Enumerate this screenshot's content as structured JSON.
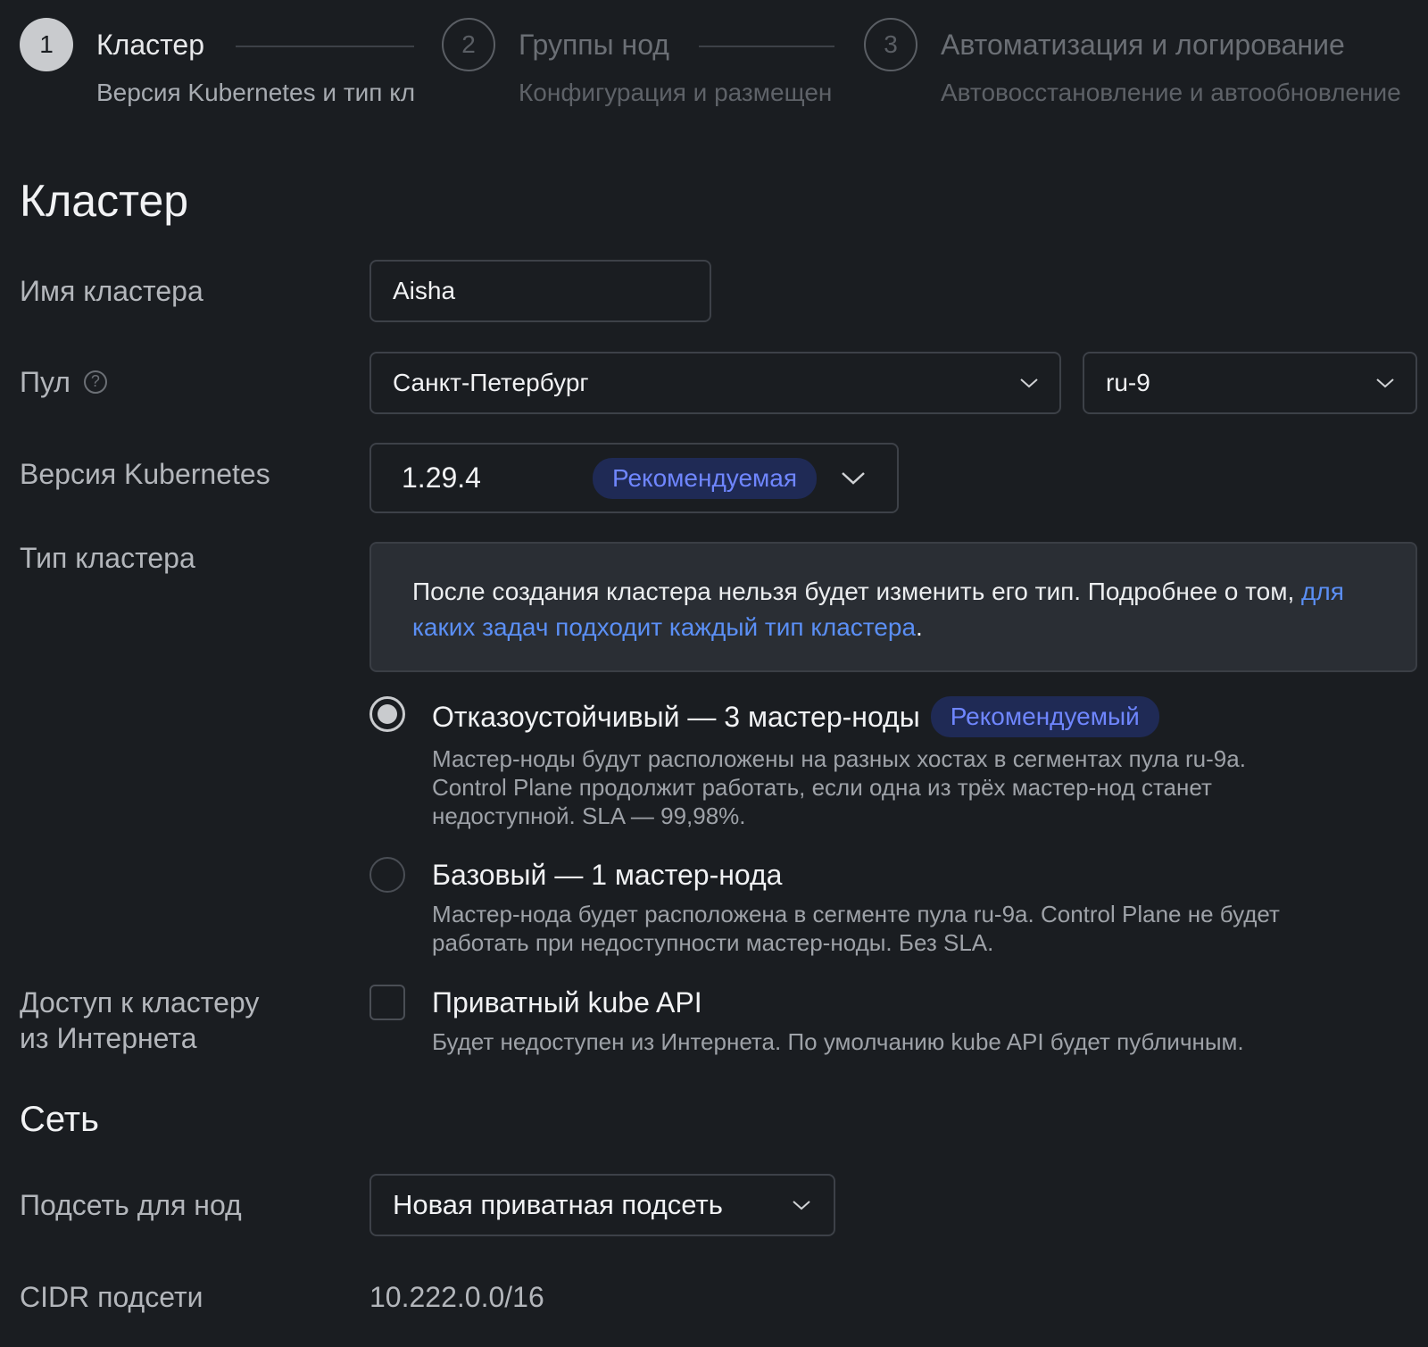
{
  "stepper": {
    "steps": [
      {
        "number": "1",
        "title": "Кластер",
        "subtitle": "Версия Kubernetes и тип кл"
      },
      {
        "number": "2",
        "title": "Группы нод",
        "subtitle": "Конфигурация и размещен"
      },
      {
        "number": "3",
        "title": "Автоматизация и логирование",
        "subtitle": "Автовосстановление и автообновление"
      }
    ]
  },
  "cluster_section": {
    "title": "Кластер",
    "name": {
      "label": "Имя кластера",
      "value": "Aisha"
    },
    "pool": {
      "label": "Пул",
      "region_value": "Санкт-Петербург",
      "pool_value": "ru-9"
    },
    "k8s_version": {
      "label": "Версия Kubernetes",
      "value": "1.29.4",
      "badge": "Рекомендуемая"
    },
    "cluster_type": {
      "label": "Тип кластера",
      "info_text": "После создания кластера нельзя будет изменить его тип. Подробнее о том, ",
      "info_link": "для каких задач подходит каждый тип кластера",
      "info_end": ".",
      "options": [
        {
          "title": "Отказоустойчивый — 3 мастер-ноды",
          "badge": "Рекомендуемый",
          "description_1": "Мастер-ноды будут расположены на разных хостах в сегментах пула ru-9a.",
          "description_2": "Control Plane продолжит работать, если одна из трёх мастер-нод станет",
          "description_3": "недоступной. SLA — 99,98%.",
          "selected": true
        },
        {
          "title": "Базовый — 1 мастер-нода",
          "description_1": "Мастер-нода будет расположена в сегменте пула ru-9a. Control Plane не будет",
          "description_2": "работать при недоступности мастер-ноды. Без SLA.",
          "selected": false
        }
      ]
    },
    "internet_access": {
      "label_line1": "Доступ к кластеру",
      "label_line2": "из Интернета",
      "checkbox_title": "Приватный kube API",
      "checkbox_description": "Будет недоступен из Интернета. По умолчанию kube API будет публичным.",
      "checked": false
    }
  },
  "network_section": {
    "title": "Сеть",
    "subnet": {
      "label": "Подсеть для нод",
      "value": "Новая приватная подсеть"
    },
    "cidr": {
      "label": "CIDR подсети",
      "value": "10.222.0.0/16"
    }
  },
  "colors": {
    "background": "#1a1d21",
    "badge_bg": "#1f2a55",
    "badge_text": "#6f86ff",
    "link": "#5b8ff5"
  }
}
